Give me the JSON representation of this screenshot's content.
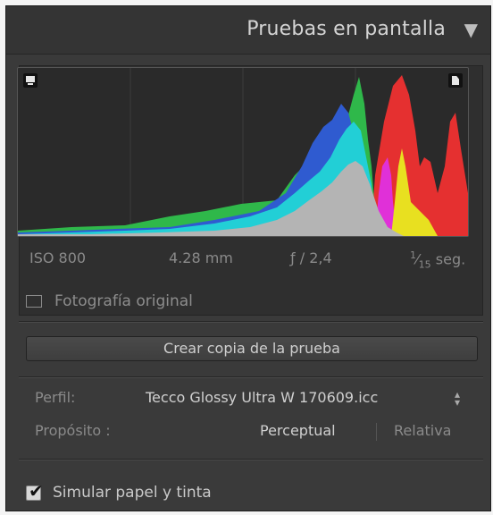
{
  "header": {
    "title": "Pruebas en pantalla",
    "collapse_icon": "triangle-down-icon"
  },
  "histogram": {
    "shadow_clip_icon": "monitor-icon",
    "highlight_clip_icon": "document-icon",
    "colors": {
      "blue": "#2f5bd0",
      "cyan": "#22cfd6",
      "green": "#2fb84a",
      "red": "#e53030",
      "yellow": "#e8e020",
      "magenta": "#e030d8",
      "gray": "#b4b4b4"
    }
  },
  "exif": {
    "iso": "ISO 800",
    "focal": "4.28 mm",
    "aperture": "ƒ / 2,4",
    "shutter_num": "1",
    "shutter_sep": "⁄",
    "shutter_den": "15",
    "shutter_unit": "seg."
  },
  "original": {
    "label": "Fotografía original",
    "checked": false
  },
  "copy_button": {
    "label": "Crear copia de la prueba"
  },
  "profile": {
    "label": "Perfil:",
    "value": "Tecco Glossy Ultra W 170609.icc"
  },
  "intent": {
    "label": "Propósito :",
    "options": [
      "Perceptual",
      "Relativa"
    ],
    "selected": "Perceptual"
  },
  "simulate": {
    "label": "Simular papel y tinta",
    "checked": true
  }
}
